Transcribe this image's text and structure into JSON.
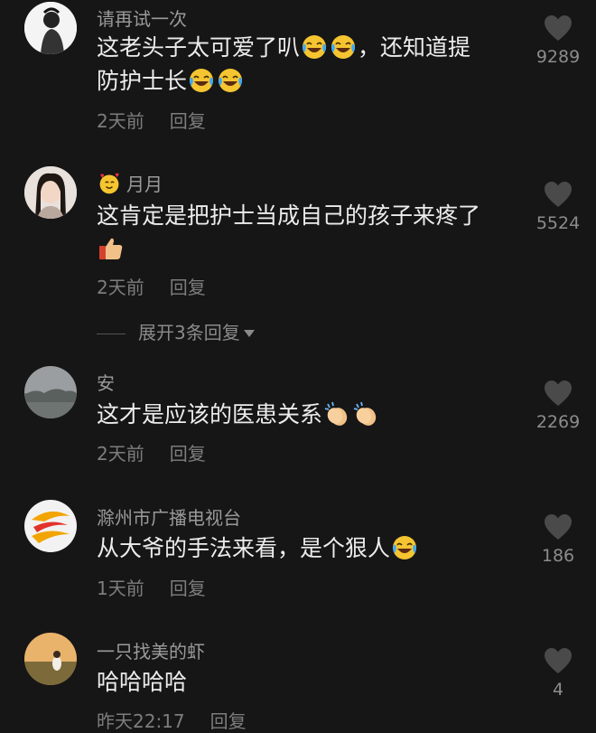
{
  "comments": [
    {
      "username": "请再试一次",
      "text_line1": "这老头子太可爱了叭",
      "text_mid": "，还知道提",
      "text_line2": "防护士长",
      "time": "2天前",
      "reply": "回复",
      "likes": "9289",
      "avatar_icon": "monochrome-portrait-avatar"
    },
    {
      "username": "月月",
      "username_prefix_icon": "smiling-face-with-hearts-emoji",
      "text": "这肯定是把护士当成自己的孩子来疼了",
      "time": "2天前",
      "reply": "回复",
      "likes": "5524",
      "avatar_icon": "woman-portrait-avatar"
    },
    {
      "expand_label": "展开3条回复"
    },
    {
      "username": "安",
      "text": "这才是应该的医患关系",
      "time": "2天前",
      "reply": "回复",
      "likes": "2269",
      "avatar_icon": "misty-landscape-avatar"
    },
    {
      "username": "滁州市广播电视台",
      "text": "从大爷的手法来看，是个狠人",
      "time": "1天前",
      "reply": "回复",
      "likes": "186",
      "avatar_icon": "broadcast-logo-avatar"
    },
    {
      "username": "一只找美的虾",
      "text": "哈哈哈哈",
      "time": "昨天22:17",
      "reply": "回复",
      "likes": "4",
      "avatar_icon": "sunset-silhouette-avatar"
    }
  ],
  "colors": {
    "background": "#161616",
    "text": "#ececec",
    "secondary": "#9a9a9a"
  }
}
